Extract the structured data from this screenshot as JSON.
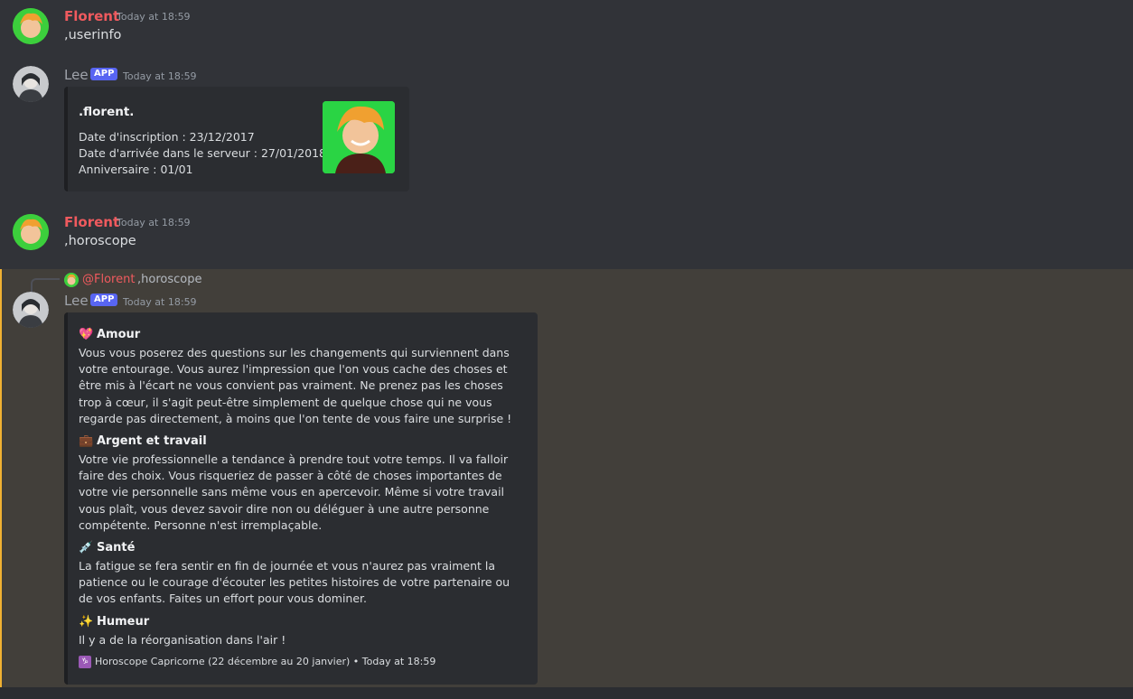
{
  "messages": [
    {
      "user": "Florent",
      "time": "Today at 18:59",
      "text": ",userinfo"
    },
    {
      "user": "Lee",
      "badge": "APP",
      "time": "Today at 18:59"
    },
    {
      "user": "Florent",
      "time": "Today at 18:59",
      "text": ",horoscope"
    },
    {
      "user": "Lee",
      "badge": "APP",
      "time": "Today at 18:59"
    }
  ],
  "userinfo_embed": {
    "title": ".florent.",
    "lines": [
      "Date d'inscription : 23/12/2017",
      "Date d'arrivée dans le serveur : 27/01/2018",
      "Anniversaire : 01/01"
    ]
  },
  "reply": {
    "mention": "@Florent",
    "text": ",horoscope"
  },
  "horoscope_embed": {
    "sections": [
      {
        "emoji": "💖",
        "title": "Amour",
        "body": "Vous vous poserez des questions sur les changements qui surviennent dans votre entourage. Vous aurez l'impression que l'on vous cache des choses et être mis à l'écart ne vous convient pas vraiment. Ne prenez pas les choses trop à cœur, il s'agit peut-être simplement de quelque chose qui ne vous regarde pas directement, à moins que l'on tente de vous faire une surprise !"
      },
      {
        "emoji": "💼",
        "title": "Argent et travail",
        "body": "Votre vie professionnelle a tendance à prendre tout votre temps. Il va falloir faire des choix. Vous risqueriez de passer à côté de choses importantes de votre vie personnelle sans même vous en apercevoir. Même si votre travail vous plaît, vous devez savoir dire non ou déléguer à une autre personne compétente. Personne n'est irremplaçable."
      },
      {
        "emoji": "💉",
        "title": "Santé",
        "body": "La fatigue se fera sentir en fin de journée et vous n'aurez pas vraiment la patience ou le courage d'écouter les petites histoires de votre partenaire ou de vos enfants. Faites un effort pour vous dominer."
      },
      {
        "emoji": "✨",
        "title": "Humeur",
        "body": "Il y a de la réorganisation dans l'air !"
      }
    ],
    "footer_icon": "♑",
    "footer": "Horoscope Capricorne (22 décembre au 20 janvier) • Today at 18:59"
  },
  "colors": {
    "florent": "#f05a5e",
    "app_badge": "#5865f2",
    "highlight_border": "#f0b132"
  }
}
